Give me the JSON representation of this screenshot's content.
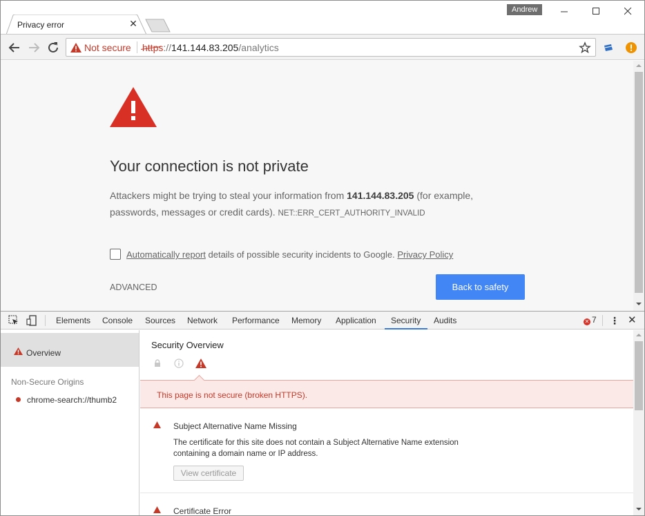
{
  "window": {
    "profile_name": "Andrew",
    "controls": [
      "minimize",
      "maximize",
      "close"
    ]
  },
  "tab": {
    "title": "Privacy error",
    "close_glyph": "✕"
  },
  "toolbar": {
    "security_label": "Not secure",
    "url_scheme": "https",
    "url_sep": "://",
    "url_host": "141.144.83.205",
    "url_path": "/analytics"
  },
  "interstitial": {
    "heading": "Your connection is not private",
    "line1_prefix": "Attackers might be trying to steal your information from ",
    "host": "141.144.83.205",
    "line1_suffix": " (for example,",
    "line2": "passwords, messages or credit cards). ",
    "error_code": "NET::ERR_CERT_AUTHORITY_INVALID",
    "checkbox_link": "Automatically report",
    "checkbox_text": " details of possible security incidents to Google. ",
    "privacy_link": "Privacy Policy",
    "advanced_label": "ADVANCED",
    "safety_button": "Back to safety"
  },
  "devtools": {
    "tabs": [
      "Elements",
      "Console",
      "Sources",
      "Network",
      "Performance",
      "Memory",
      "Application",
      "Security",
      "Audits"
    ],
    "active_tab": "Security",
    "error_count": "7",
    "sidebar": {
      "overview_label": "Overview",
      "section_heading": "Non-Secure Origins",
      "origins": [
        "chrome-search://thumb2"
      ]
    },
    "main": {
      "title": "Security Overview",
      "summary": "This page is not secure (broken HTTPS).",
      "issues": [
        {
          "title": "Subject Alternative Name Missing",
          "description": "The certificate for this site does not contain a Subject Alternative Name extension containing a domain name or IP address.",
          "button": "View certificate"
        },
        {
          "title": "Certificate Error"
        }
      ]
    }
  },
  "colors": {
    "danger": "#c53929",
    "primary_button": "#4285f4",
    "page_background": "#f7f7f7"
  }
}
